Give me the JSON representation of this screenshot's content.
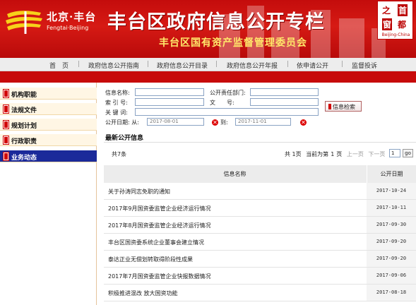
{
  "header": {
    "logo_cn": "北京·丰台",
    "logo_en": "Fengtai·Beijing",
    "title": "丰台区政府信息公开专栏",
    "subtitle": "丰台区国有资产监督管理委员会",
    "seal_chars": [
      "之",
      "首",
      "窗",
      "都"
    ],
    "seal_en": "Beijing-China",
    "brand_color": "#c40c0c"
  },
  "nav": {
    "items": [
      "首　页",
      "政府信息公开指南",
      "政府信息公开目录",
      "政府信息公开年报",
      "依申请公开",
      "监督投诉"
    ],
    "separator": "|"
  },
  "sidebar": {
    "items": [
      {
        "label": "机构职能",
        "active": false
      },
      {
        "label": "法规文件",
        "active": false
      },
      {
        "label": "规划计划",
        "active": false
      },
      {
        "label": "行政职责",
        "active": false
      },
      {
        "label": "业务动态",
        "active": true
      }
    ]
  },
  "search": {
    "info_name_label": "信息名称:",
    "responsible_dept_label": "公开责任部门:",
    "index_no_label": "索 引 号:",
    "doc_no_label": "文　　号:",
    "keyword_label": "关 键 词:",
    "date_label": "公开日期: 从:",
    "date_to_label": "到:",
    "date_from": "2017-08-01",
    "date_to": "2017-11-01",
    "button_label": "信息检索"
  },
  "latest": {
    "title": "最新公开信息",
    "total": "共7条",
    "pager": {
      "total_pages": "共 1页",
      "current_prefix": "当前为第",
      "current": "1",
      "current_suffix": "页",
      "prev": "上一页",
      "next": "下一页",
      "page_input": "1",
      "go": "go"
    }
  },
  "table": {
    "columns": [
      "信息名称",
      "公开日期"
    ],
    "rows": [
      {
        "name": "关于孙涛同志免职的通知",
        "date": "2017-10-24"
      },
      {
        "name": "2017年9月国资委监管企业经济运行情况",
        "date": "2017-10-11"
      },
      {
        "name": "2017年8月国资委监管企业经济运行情况",
        "date": "2017-09-30"
      },
      {
        "name": "丰台区国资委系统企业董事会建立情况",
        "date": "2017-09-20"
      },
      {
        "name": "泰达正业无偿划转取得阶段性成果",
        "date": "2017-09-20"
      },
      {
        "name": "2017年7月国资委监管企业快报数据情况",
        "date": "2017-09-06"
      },
      {
        "name": "积极推进混改 放大国资功能",
        "date": "2017-08-18"
      }
    ]
  }
}
